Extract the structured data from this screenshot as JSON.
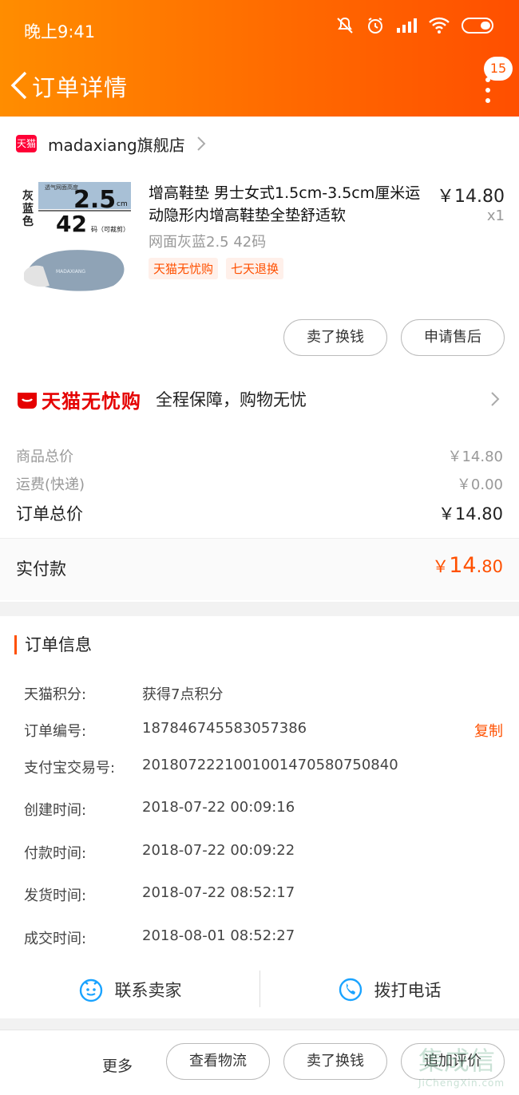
{
  "status_bar": {
    "time": "晚上9:41"
  },
  "nav": {
    "title": "订单详情",
    "badge": "15"
  },
  "shop": {
    "logo_text": "天猫",
    "name": "madaxiang旗舰店"
  },
  "product": {
    "title": "增高鞋垫 男士女式1.5cm-3.5cm厘米运动隐形内增高鞋垫全垫舒适软",
    "price": "￥14.80",
    "qty": "x1",
    "sku": "网面灰蓝2.5 42码",
    "tags": [
      "天猫无忧购",
      "七天退换"
    ],
    "thumb": {
      "color_label": "灰蓝色",
      "height": "2.5",
      "unit": "cm",
      "size": "42",
      "size_label": "码（可裁剪）",
      "sub": "透气网面高度",
      "brand": "MADAXIANG"
    }
  },
  "actions": {
    "sell": "卖了换钱",
    "after_sale": "申请售后"
  },
  "wuyou": {
    "logo": "天猫无忧购",
    "slogan": "全程保障，购物无忧"
  },
  "totals": {
    "goods_label": "商品总价",
    "goods_value": "￥14.80",
    "ship_label": "运费(快递)",
    "ship_value": "￥0.00",
    "order_label": "订单总价",
    "order_value": "￥14.80",
    "paid_label": "实付款",
    "paid_currency": "￥",
    "paid_int": "14",
    "paid_dec": ".80"
  },
  "order_info": {
    "title": "订单信息",
    "rows": [
      {
        "k": "天猫积分:",
        "v": "获得7点积分"
      },
      {
        "k": "订单编号:",
        "v": "187846745583057386"
      },
      {
        "k": "支付宝交易号:",
        "v": "2018072221001001470580750840"
      },
      {
        "k": "创建时间:",
        "v": "2018-07-22 00:09:16"
      },
      {
        "k": "付款时间:",
        "v": "2018-07-22 00:09:22"
      },
      {
        "k": "发货时间:",
        "v": "2018-07-22 08:52:17"
      },
      {
        "k": "成交时间:",
        "v": "2018-08-01 08:52:27"
      }
    ],
    "copy_label": "复制"
  },
  "contact": {
    "seller": "联系卖家",
    "call": "拨打电话"
  },
  "bottom_bar": {
    "more": "更多",
    "logistics": "查看物流",
    "sell": "卖了换钱",
    "review": "追加评价"
  },
  "watermark": {
    "big": "集成信",
    "small": "JiChengXin.com"
  },
  "colors": {
    "accent": "#ff5000",
    "header_start": "#ff8d00",
    "header_end": "#ff4f00",
    "tmall_red": "#e50000"
  }
}
